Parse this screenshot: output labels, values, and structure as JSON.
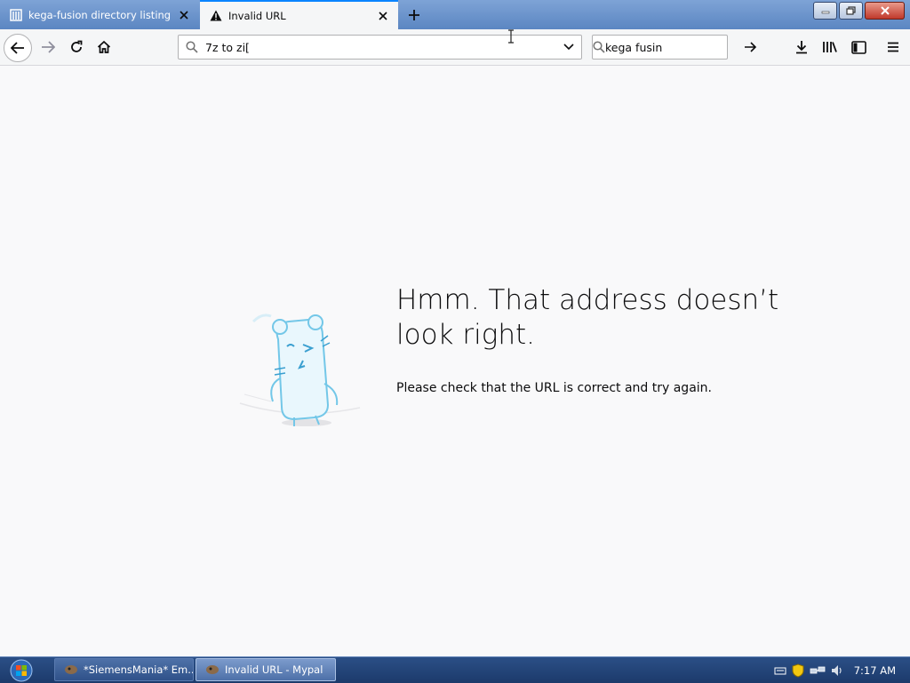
{
  "tabs": [
    {
      "title": "kega-fusion directory listing",
      "favicon": "library-icon",
      "active": false
    },
    {
      "title": "Invalid URL",
      "favicon": "warning-icon",
      "active": true
    }
  ],
  "urlbar": {
    "value": "7z to zi["
  },
  "searchbar": {
    "value": "kega fusin"
  },
  "error": {
    "title": "Hmm. That address doesn’t look right.",
    "description": "Please check that the URL is correct and try again."
  },
  "taskbar": {
    "items": [
      {
        "label": "*SiemensMania* Em..."
      },
      {
        "label": "Invalid URL - Mypal"
      }
    ],
    "clock": "7:17 AM"
  },
  "colors": {
    "accent": "#0a84ff",
    "illustration": "#73c7e8"
  }
}
